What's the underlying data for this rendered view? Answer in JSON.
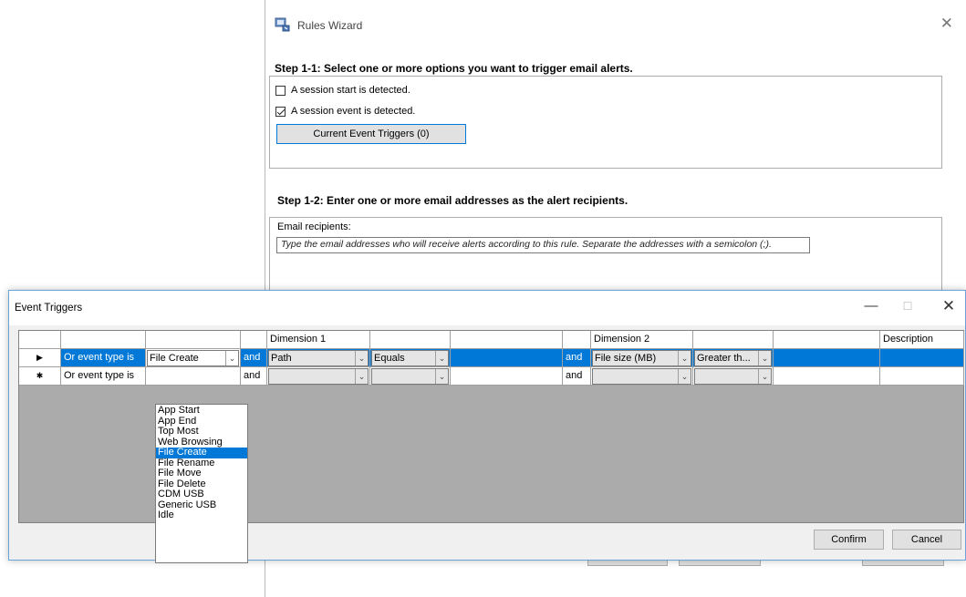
{
  "rules_wizard": {
    "title": "Rules Wizard",
    "close_glyph": "✕",
    "step1_title": "Step 1-1: Select one or more options you want to trigger email alerts.",
    "options": [
      {
        "label": "A session start is detected.",
        "checked": false
      },
      {
        "label": "A session event is detected.",
        "checked": true
      }
    ],
    "current_triggers_button": "Current Event Triggers (0)",
    "step2_title": "Step 1-2: Enter one or more email addresses as the alert recipients.",
    "email_label": "Email recipients:",
    "email_placeholder": "Type the email addresses who will receive alerts according to this rule. Separate the addresses with a semicolon (;)."
  },
  "event_triggers": {
    "title": "Event Triggers",
    "min_glyph": "—",
    "max_glyph": "☐",
    "close_glyph": "✕",
    "headers": {
      "dimension1": "Dimension 1",
      "dimension2": "Dimension 2",
      "description": "Description"
    },
    "rows": [
      {
        "marker": "▶",
        "prefix": "Or event type is",
        "event_type": "File Create",
        "and1": "and",
        "dim1_field": "Path",
        "dim1_operator": "Equals",
        "dim1_value": "",
        "and2": "and",
        "dim2_field": "File size (MB)",
        "dim2_operator": "Greater th...",
        "dim2_value": "",
        "description": ""
      },
      {
        "marker": "✱",
        "prefix": "Or event type is",
        "event_type": "",
        "and1": "and",
        "dim1_field": "",
        "dim1_operator": "",
        "dim1_value": "",
        "and2": "and",
        "dim2_field": "",
        "dim2_operator": "",
        "dim2_value": "",
        "description": ""
      }
    ],
    "event_type_options": [
      "App Start",
      "App End",
      "Top Most",
      "Web Browsing",
      "File Create",
      "File Rename",
      "File Move",
      "File Delete",
      "CDM USB",
      "Generic USB",
      "Idle"
    ],
    "selected_option": "File Create",
    "confirm_button": "Confirm",
    "cancel_button": "Cancel"
  },
  "colors": {
    "selection_blue": "#0078d7",
    "grid_background": "#ababab"
  }
}
